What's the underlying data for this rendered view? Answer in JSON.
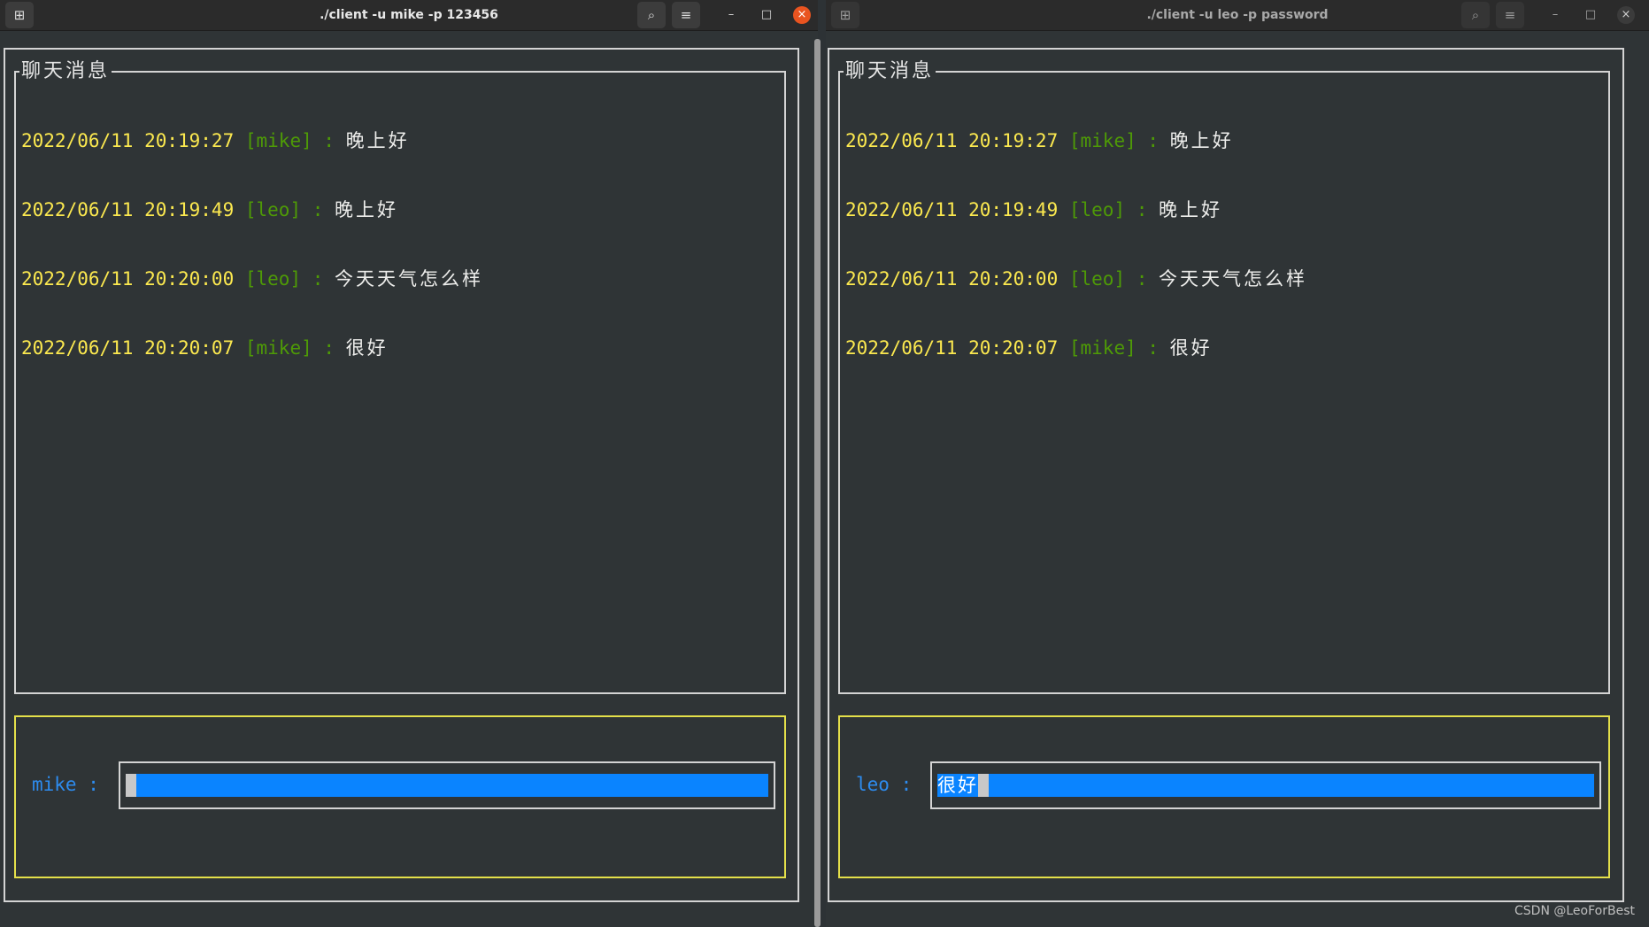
{
  "windows": [
    {
      "title": "./client -u mike -p 123456",
      "chat_title": "聊天消息",
      "messages": [
        {
          "timestamp": "2022/06/11 20:19:27",
          "user": "[mike]",
          "sep": " : ",
          "text": "晚上好"
        },
        {
          "timestamp": "2022/06/11 20:19:49",
          "user": "[leo]",
          "sep": " : ",
          "text": "晚上好"
        },
        {
          "timestamp": "2022/06/11 20:20:00",
          "user": "[leo]",
          "sep": " : ",
          "text": "今天天气怎么样"
        },
        {
          "timestamp": "2022/06/11 20:20:07",
          "user": "[mike]",
          "sep": " : ",
          "text": "很好"
        }
      ],
      "prompt": "mike :",
      "input_value": ""
    },
    {
      "title": "./client -u leo -p password",
      "chat_title": "聊天消息",
      "messages": [
        {
          "timestamp": "2022/06/11 20:19:27",
          "user": "[mike]",
          "sep": " : ",
          "text": "晚上好"
        },
        {
          "timestamp": "2022/06/11 20:19:49",
          "user": "[leo]",
          "sep": " : ",
          "text": "晚上好"
        },
        {
          "timestamp": "2022/06/11 20:20:00",
          "user": "[leo]",
          "sep": " : ",
          "text": "今天天气怎么样"
        },
        {
          "timestamp": "2022/06/11 20:20:07",
          "user": "[mike]",
          "sep": " : ",
          "text": "很好"
        }
      ],
      "prompt": "leo :",
      "input_value": "很好"
    }
  ],
  "titlebar_buttons": {
    "new_tab": "⊞",
    "search": "⌕",
    "menu": "≡",
    "minimize": "–",
    "maximize": "□",
    "close": "×"
  },
  "icons": [
    "new-tab-icon",
    "search-icon",
    "hamburger-menu-icon",
    "minimize-icon",
    "maximize-icon",
    "close-icon"
  ],
  "colors": {
    "timestamp": "#fce94f",
    "username": "#4e9a06",
    "prompt": "#2d8cf0",
    "input_bg": "#0a84ff",
    "input_border": "#e5e04a",
    "close_active": "#e95420"
  },
  "watermark": "CSDN @LeoForBest"
}
